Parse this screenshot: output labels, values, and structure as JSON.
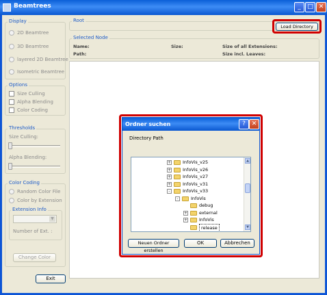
{
  "window": {
    "title": "Beamtrees"
  },
  "display": {
    "title": "Display",
    "options": [
      "2D Beamtree",
      "3D Beamtree",
      "layered 2D Beamtree",
      "Isometric Beamtree"
    ]
  },
  "options": {
    "title": "Options",
    "checks": [
      "Size Culling",
      "Alpha Blending",
      "Color Coding"
    ]
  },
  "thresholds": {
    "title": "Thresholds",
    "size_culling": "Size Culling:",
    "alpha_blending": "Alpha Blending:"
  },
  "color_coding": {
    "title": "Color Coding",
    "options": [
      "Random Color File",
      "Color by Extension"
    ],
    "extension_info": "Extension Info",
    "number_of_ext": "Number of Ext. :",
    "change_color": "Change Color"
  },
  "exit_label": "Exit",
  "root": {
    "title": "Root",
    "load_directory": "Load Directory"
  },
  "selected_node": {
    "title": "Selected Node",
    "name": "Name:",
    "size": "Size:",
    "size_all_ext": "Size of all Extensions:",
    "path": "Path:",
    "size_incl_leaves": "Size incl. Leaves:"
  },
  "dialog": {
    "title": "Ordner suchen",
    "label": "Directory Path",
    "tree": [
      {
        "label": "InfoVis_v25",
        "level": 0,
        "expander": "+"
      },
      {
        "label": "InfoVis_v26",
        "level": 0,
        "expander": "+"
      },
      {
        "label": "InfoVis_v27",
        "level": 0,
        "expander": "+"
      },
      {
        "label": "InfoVis_v31",
        "level": 0,
        "expander": "+"
      },
      {
        "label": "InfoVis_v33",
        "level": 0,
        "expander": "-"
      },
      {
        "label": "InfoVis",
        "level": 1,
        "expander": "-"
      },
      {
        "label": "debug",
        "level": 2,
        "expander": ""
      },
      {
        "label": "external",
        "level": 2,
        "expander": "+"
      },
      {
        "label": "InfoVis",
        "level": 2,
        "expander": "+"
      },
      {
        "label": "release",
        "level": 2,
        "expander": "",
        "selected": true
      }
    ],
    "new_folder": "Neuen Ordner erstellen",
    "ok": "OK",
    "cancel": "Abbrechen"
  }
}
